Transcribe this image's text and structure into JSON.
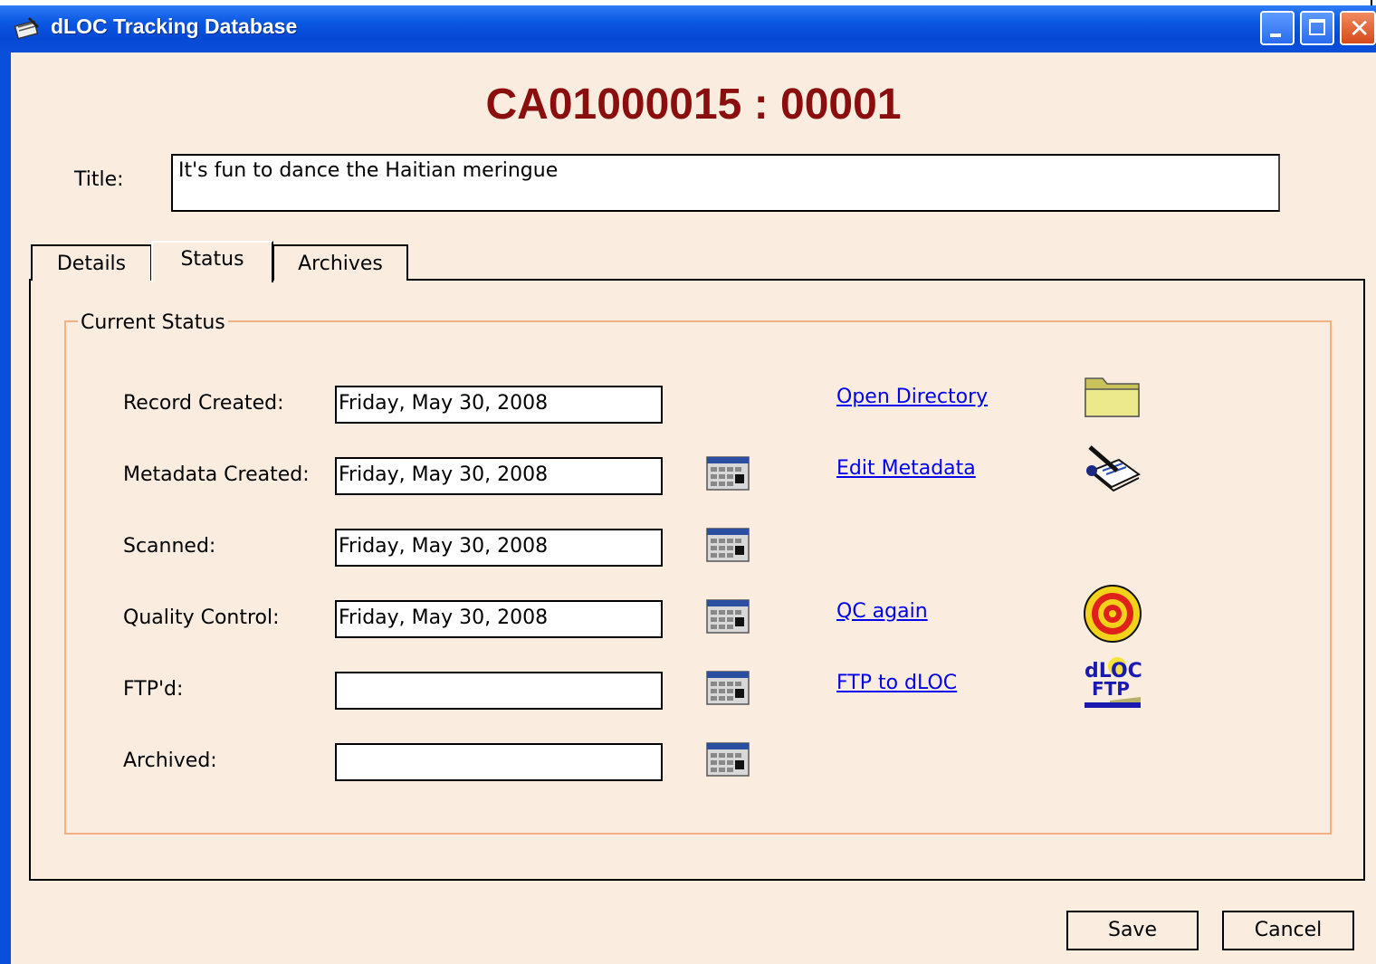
{
  "window": {
    "title": "dLOC Tracking Database",
    "close_glyph": "✕"
  },
  "record_id": "CA01000015 : 00001",
  "title_field": {
    "label": "Title:",
    "value": "It's fun to dance the Haitian meringue"
  },
  "tabs": [
    {
      "label": "Details",
      "selected": false
    },
    {
      "label": "Status",
      "selected": true
    },
    {
      "label": "Archives",
      "selected": false
    }
  ],
  "status_group": {
    "legend": "Current Status",
    "fields": [
      {
        "label": "Record Created:",
        "value": "Friday, May 30, 2008"
      },
      {
        "label": "Metadata Created:",
        "value": "Friday, May 30, 2008"
      },
      {
        "label": "Scanned:",
        "value": "Friday, May 30, 2008"
      },
      {
        "label": "Quality Control:",
        "value": "Friday, May 30, 2008"
      },
      {
        "label": "FTP'd:",
        "value": ""
      },
      {
        "label": "Archived:",
        "value": ""
      }
    ],
    "links": [
      {
        "label": "Open Directory",
        "icon": "folder-icon"
      },
      {
        "label": "Edit Metadata",
        "icon": "edit-metadata-icon"
      },
      {
        "label": "QC again",
        "icon": "target-icon"
      },
      {
        "label": "FTP to dLOC",
        "icon": "dloc-ftp-icon"
      }
    ],
    "ftp_logo": {
      "line1": "dLOC",
      "line2": "FTP"
    }
  },
  "buttons": {
    "save": "Save",
    "cancel": "Cancel"
  },
  "colors": {
    "title_bar": "#0a4fd9",
    "background": "#faede0",
    "record_id": "#8b0e0e",
    "group_border": "#f0b184",
    "link": "#0000ee"
  }
}
